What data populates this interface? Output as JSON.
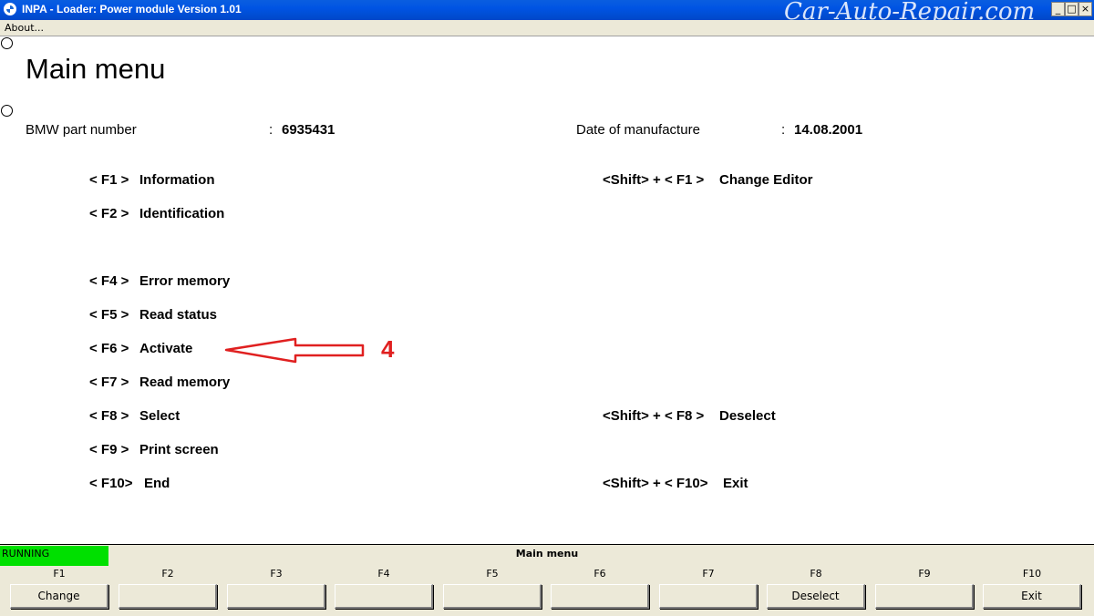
{
  "window": {
    "title": "INPA - Loader:  Power module Version 1.01",
    "watermark": "Car-Auto-Repair.com",
    "min_glyph": "_",
    "max_glyph": "□",
    "close_glyph": "×"
  },
  "menubar": {
    "about": "About..."
  },
  "main": {
    "title": "Main menu",
    "part_number_label": "BMW part number",
    "part_number_sep": ":",
    "part_number_value": "6935431",
    "manufacture_label": "Date of manufacture",
    "manufacture_sep": ":",
    "manufacture_value": "14.08.2001"
  },
  "left_keys": [
    {
      "key": "< F1 >",
      "label": "Information"
    },
    {
      "key": "< F2 >",
      "label": "Identification"
    },
    {
      "key": "< F4 >",
      "label": "Error memory"
    },
    {
      "key": "< F5 >",
      "label": "Read status"
    },
    {
      "key": "< F6 >",
      "label": "Activate"
    },
    {
      "key": "< F7 >",
      "label": "Read memory"
    },
    {
      "key": "< F8 >",
      "label": "Select"
    },
    {
      "key": "< F9 >",
      "label": "Print screen"
    },
    {
      "key": "< F10>",
      "label": "End"
    }
  ],
  "right_keys": [
    {
      "key": "<Shift> + < F1 >",
      "label": "Change Editor"
    },
    {
      "key": "<Shift> + < F8 >",
      "label": "Deselect"
    },
    {
      "key": "<Shift> + < F10>",
      "label": "Exit"
    }
  ],
  "annotation": {
    "number": "4",
    "color": "#e02020"
  },
  "panel": {
    "status": "RUNNING",
    "status_color": "#00e000",
    "title": "Main menu",
    "fkeys": [
      {
        "label": "F1",
        "button": "Change"
      },
      {
        "label": "F2",
        "button": ""
      },
      {
        "label": "F3",
        "button": ""
      },
      {
        "label": "F4",
        "button": ""
      },
      {
        "label": "F5",
        "button": ""
      },
      {
        "label": "F6",
        "button": ""
      },
      {
        "label": "F7",
        "button": ""
      },
      {
        "label": "F8",
        "button": "Deselect"
      },
      {
        "label": "F9",
        "button": ""
      },
      {
        "label": "F10",
        "button": "Exit"
      }
    ]
  }
}
